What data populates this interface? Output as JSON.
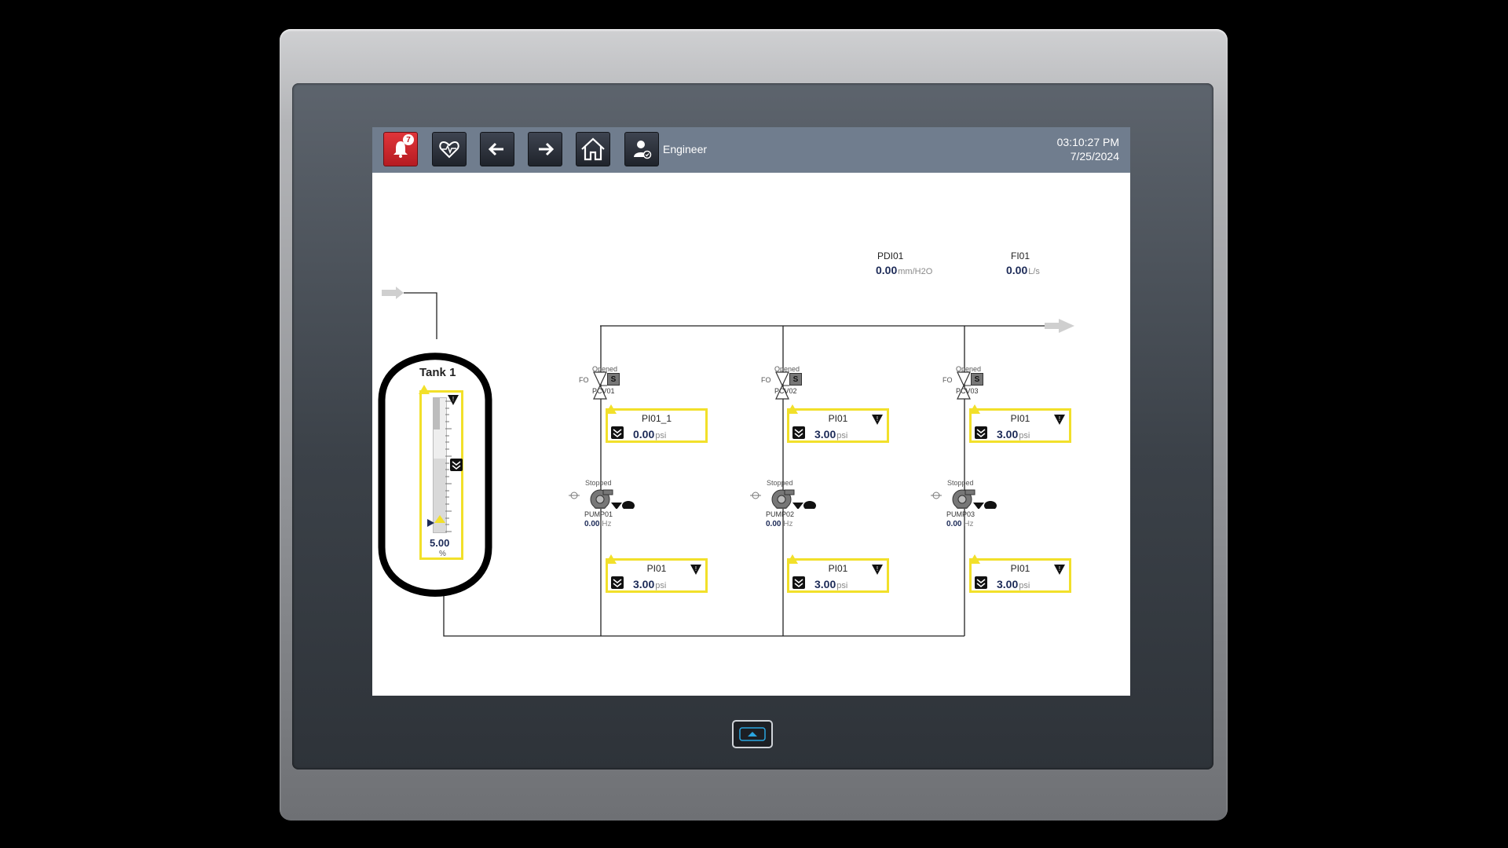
{
  "header": {
    "alarm_count": "7",
    "user": "Engineer",
    "time": "03:10:27 PM",
    "date": "7/25/2024"
  },
  "icons": [
    "bell-icon",
    "heartbeat-icon",
    "arrow-left-icon",
    "arrow-right-icon",
    "home-icon",
    "user-icon"
  ],
  "tank": {
    "name": "Tank 1",
    "level": "5.00",
    "level_unit": "%",
    "level_fraction": 0.05
  },
  "indicators": {
    "pdi": {
      "tag": "PDI01",
      "value": "0.00",
      "unit": "mm/H2O"
    },
    "fi": {
      "tag": "FI01",
      "value": "0.00",
      "unit": "L/s"
    }
  },
  "valves": [
    {
      "tag": "PCV01",
      "state": "Opened",
      "fail": "FO",
      "solenoid": "S"
    },
    {
      "tag": "PCV02",
      "state": "Opened",
      "fail": "FO",
      "solenoid": "S"
    },
    {
      "tag": "PCV03",
      "state": "Opened",
      "fail": "FO",
      "solenoid": "S"
    }
  ],
  "pumps": [
    {
      "tag": "PUMP01",
      "state": "Stopped",
      "value": "0.00",
      "unit": "Hz"
    },
    {
      "tag": "PUMP02",
      "state": "Stopped",
      "value": "0.00",
      "unit": "Hz"
    },
    {
      "tag": "PUMP03",
      "state": "Stopped",
      "value": "0.00",
      "unit": "Hz"
    }
  ],
  "pressure_upper": [
    {
      "tag": "PI01_1",
      "value": "0.00",
      "unit": "psi"
    },
    {
      "tag": "PI01",
      "value": "3.00",
      "unit": "psi"
    },
    {
      "tag": "PI01",
      "value": "3.00",
      "unit": "psi"
    }
  ],
  "pressure_lower": [
    {
      "tag": "PI01",
      "value": "3.00",
      "unit": "psi"
    },
    {
      "tag": "PI01",
      "value": "3.00",
      "unit": "psi"
    },
    {
      "tag": "PI01",
      "value": "3.00",
      "unit": "psi"
    }
  ],
  "colors": {
    "header": "#707d8e",
    "alarm": "#d8262c",
    "highlight": "#f2e02a",
    "value_text": "#1c2a57"
  }
}
